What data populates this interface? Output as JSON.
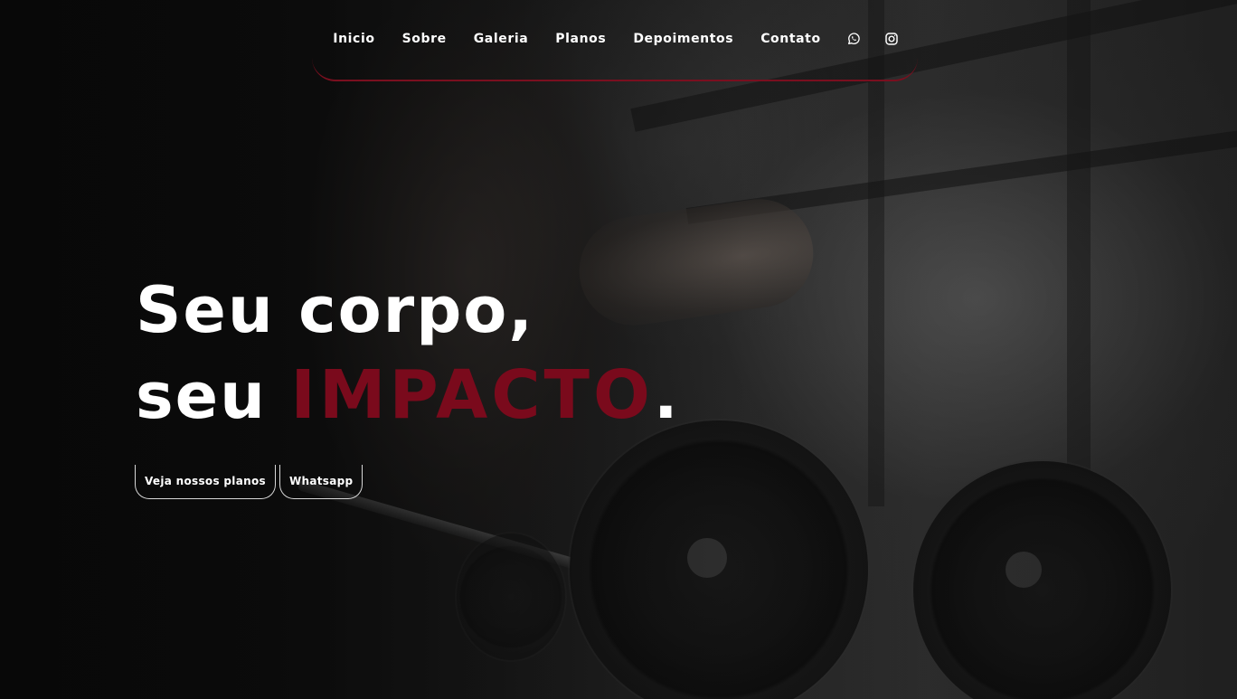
{
  "nav": {
    "items": [
      {
        "label": "Inicio"
      },
      {
        "label": "Sobre"
      },
      {
        "label": "Galeria"
      },
      {
        "label": "Planos"
      },
      {
        "label": "Depoimentos"
      },
      {
        "label": "Contato"
      }
    ],
    "icons": [
      "whatsapp-icon",
      "instagram-icon"
    ],
    "accent_color": "#7a0f1f"
  },
  "hero": {
    "line1": "Seu corpo,",
    "line2_prefix": "seu ",
    "line2_accent": "IMPACTO",
    "line2_suffix": ".",
    "accent_color": "#7a0a1c",
    "buttons": {
      "plans_label": "Veja nossos planos",
      "whatsapp_label": "Whatsapp"
    }
  }
}
